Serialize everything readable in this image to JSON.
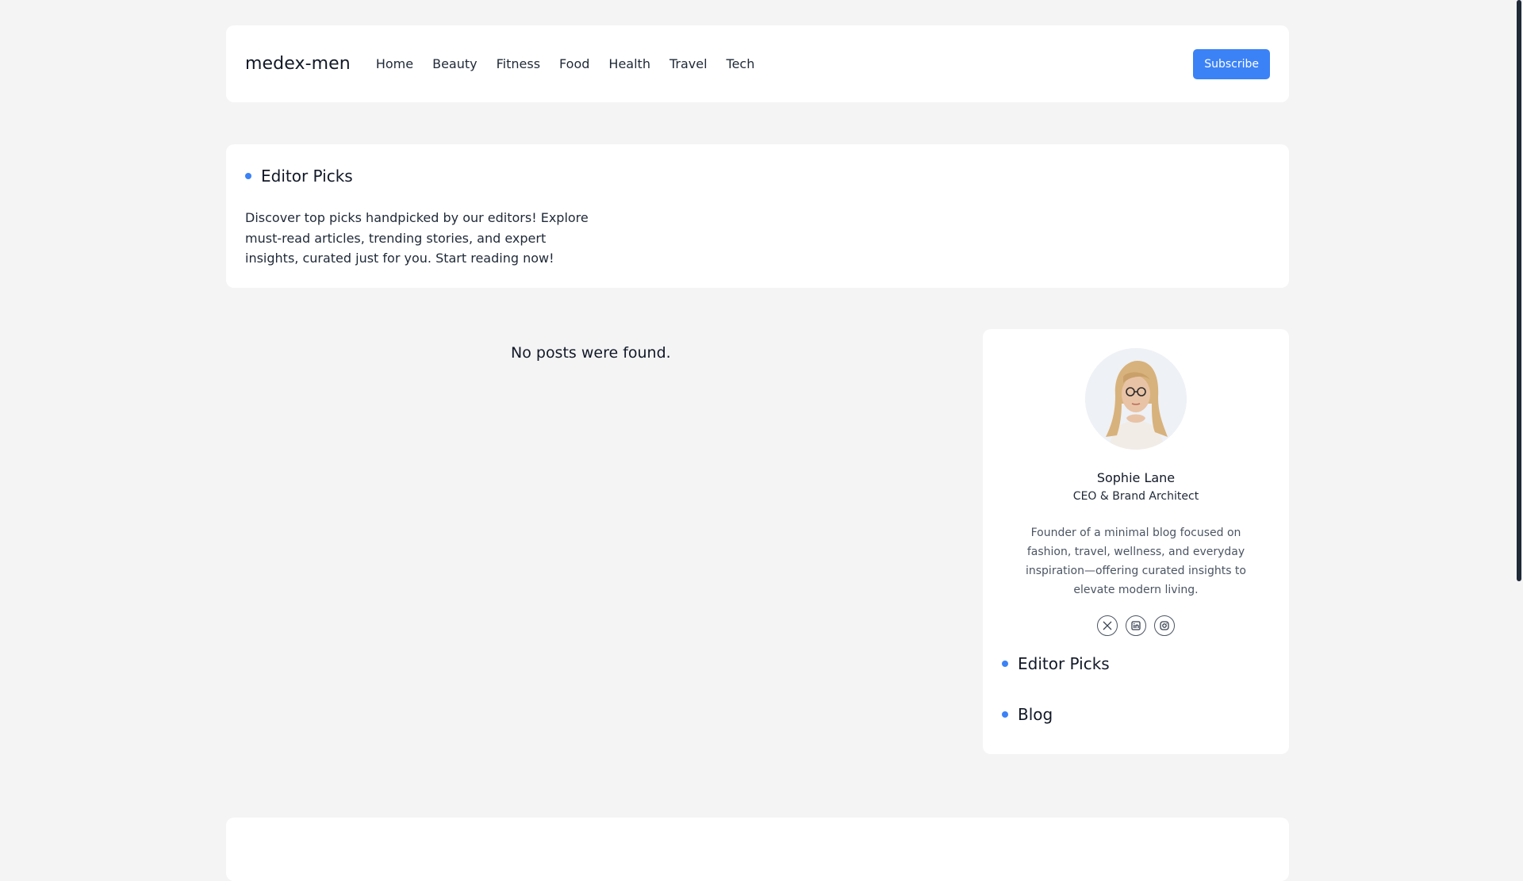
{
  "header": {
    "logo": "medex-men",
    "nav": [
      "Home",
      "Beauty",
      "Fitness",
      "Food",
      "Health",
      "Travel",
      "Tech"
    ],
    "subscribe_label": "Subscribe"
  },
  "hero": {
    "title": "Editor Picks",
    "description": "Discover top picks handpicked by our editors! Explore must-read articles, trending stories, and expert insights, curated just for you. Start reading now!"
  },
  "posts": {
    "empty_message": "No posts were found."
  },
  "sidebar": {
    "author": {
      "name": "Sophie Lane",
      "role": "CEO & Brand Architect",
      "bio": "Founder of a minimal blog focused on fashion, travel, wellness, and everyday inspiration—offering curated insights to elevate modern living."
    },
    "socials": [
      {
        "icon": "x-icon",
        "glyph": "𝕏"
      },
      {
        "icon": "linkedin-icon",
        "glyph": "in"
      },
      {
        "icon": "instagram-icon",
        "glyph": "◎"
      }
    ],
    "links": [
      "Editor Picks",
      "Blog"
    ]
  },
  "colors": {
    "accent": "#3b82f6",
    "background": "#f4f4f5",
    "card": "#ffffff"
  }
}
